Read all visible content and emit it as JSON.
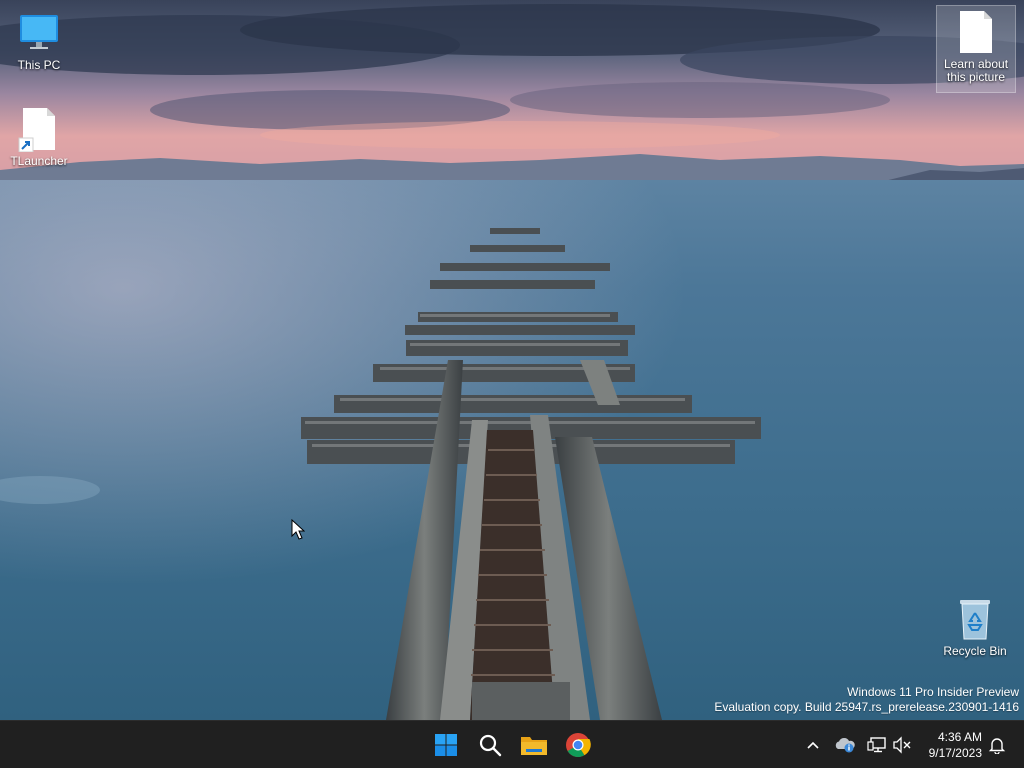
{
  "desktop": {
    "icons": [
      {
        "label": "This PC",
        "icon": "this-pc-icon"
      },
      {
        "label": "TLauncher",
        "icon": "file-shortcut-icon"
      },
      {
        "label": "Learn about this picture",
        "icon": "file-icon"
      },
      {
        "label": "Recycle Bin",
        "icon": "recycle-bin-icon"
      }
    ],
    "watermark": {
      "line1": "Windows 11 Pro Insider Preview",
      "line2": "Evaluation copy. Build 25947.rs_prerelease.230901-1416"
    }
  },
  "taskbar": {
    "apps": [
      {
        "name": "Start",
        "icon": "windows-start-icon"
      },
      {
        "name": "Search",
        "icon": "search-icon"
      },
      {
        "name": "File Explorer",
        "icon": "file-explorer-icon"
      },
      {
        "name": "Google Chrome",
        "icon": "chrome-icon"
      }
    ],
    "tray": {
      "icons": [
        "chevron-up-icon",
        "onedrive-icon",
        "network-icon",
        "volume-muted-icon",
        "notification-bell-icon"
      ],
      "time": "4:36 AM",
      "date": "9/17/2023"
    }
  },
  "colors": {
    "taskbar": "#202020",
    "start_blue": "#1b8ee8",
    "folder_yellow": "#f2b92b"
  }
}
